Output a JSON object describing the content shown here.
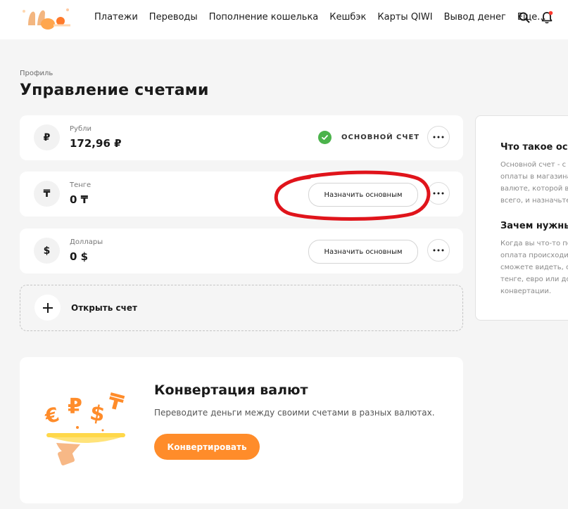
{
  "header": {
    "logo_icon": "qiwi-logo-icon",
    "nav": [
      {
        "label": "Платежи"
      },
      {
        "label": "Переводы"
      },
      {
        "label": "Пополнение кошелька"
      },
      {
        "label": "Кешбэк"
      },
      {
        "label": "Карты QIWI"
      },
      {
        "label": "Вывод денег"
      },
      {
        "label": "Еще..."
      }
    ],
    "search_icon": "search-icon",
    "bell_icon": "bell-icon"
  },
  "breadcrumb": "Профиль",
  "page_title": "Управление счетами",
  "accounts": [
    {
      "symbol": "₽",
      "name": "Рубли",
      "balance": "172,96 ₽",
      "is_main": true,
      "main_label": "ОСНОВНОЙ СЧЕТ"
    },
    {
      "symbol": "₸",
      "name": "Тенге",
      "balance": "0 ₸",
      "is_main": false,
      "action_label": "Назначить основным"
    },
    {
      "symbol": "$",
      "name": "Доллары",
      "balance": "0 $",
      "is_main": false,
      "action_label": "Назначить основным"
    }
  ],
  "open_account": {
    "label": "Открыть счет"
  },
  "info_panel": {
    "q1_title": "Что такое осн",
    "q1_lines": [
      "Основной счет - с",
      "оплаты в магазина",
      "валюте, которой в",
      "всего, и назначьте"
    ],
    "q2_title": "Зачем нужны",
    "q2_lines": [
      "Когда вы что-то по",
      "оплата происходи",
      "сможете видеть, с",
      "тенге, евро или до",
      "конвертации."
    ]
  },
  "conversion": {
    "title": "Конвертация валют",
    "description": "Переводите деньги между своими счетами в разных валютах.",
    "button": "Конвертировать"
  },
  "colors": {
    "accent": "#ff8c2a",
    "check": "#4bb34b",
    "annotation": "#e0141b",
    "notification_dot": "#ff3b30"
  }
}
